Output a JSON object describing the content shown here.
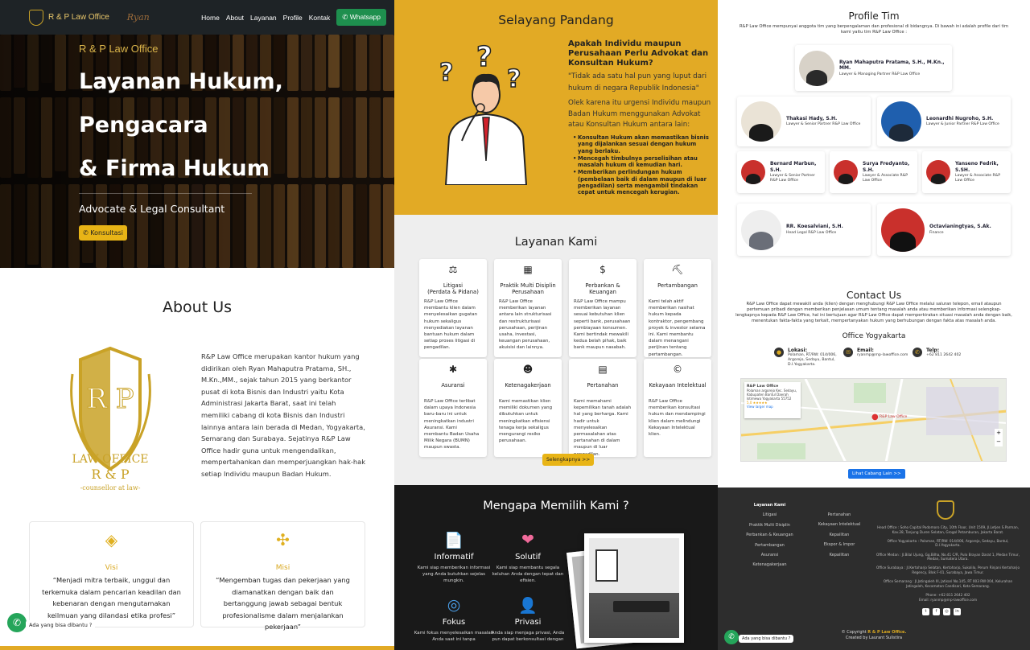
{
  "nav": {
    "brand": "R & P Law Office",
    "links": [
      "Home",
      "About",
      "Layanan",
      "Profile",
      "Kontak"
    ],
    "whatsapp": "Whatsapp",
    "signature": "Ryan"
  },
  "hero": {
    "subtitle": "R & P Law Office",
    "title_lines": [
      "Layanan Hukum,",
      "Pengacara",
      "& Firma Hukum"
    ],
    "tagline": "Advocate & Legal Consultant",
    "cta": "Konsultasi"
  },
  "about": {
    "heading": "About Us",
    "logo_text": [
      "LAW OFFICE",
      "R & P",
      "-counsellor at law-"
    ],
    "text": "R&P Law Office merupakan kantor hukum yang didirikan oleh Ryan Mahaputra Pratama, SH., M.Kn.,MM., sejak tahun 2015 yang berkantor pusat di kota Bisnis dan Industri yaitu Kota Administrasi Jakarta Barat, saat ini telah memiliki cabang di kota Bisnis dan Industri lainnya antara lain berada di Medan, Yogyakarta, Semarang dan Surabaya. Sejatinya R&P Law Office hadir guna untuk mengendalikan, mempertahankan dan memperjuangkan hak-hak setiap Individu maupun Badan Hukum.",
    "visi": {
      "title": "Visi",
      "quote": "“Menjadi mitra terbaik, unggul dan terkemuka dalam pencarian keadilan dan kebenaran dengan mengutamakan keilmuan yang dilandasi etika profesi”"
    },
    "misi": {
      "title": "Misi",
      "quote": "“Mengemban tugas dan pekerjaan yang diamanatkan dengan baik dan bertanggung jawab sebagai bentuk profesionalisme dalam menjalankan pekerjaan”"
    }
  },
  "chat": {
    "label": "Ada yang bisa dibantu ?"
  },
  "selayang": {
    "heading": "Selayang Pandang",
    "question": "Apakah Individu maupun Perusahaan Perlu Advokat dan Konsultan Hukum?",
    "quote": "\"Tidak ada satu hal pun yang luput dari hukum di negara Republik Indonesia\"",
    "para": "Olek karena itu urgensi Individu maupun Badan Hukum menggunakan Advokat atau Konsultan Hukum antara lain:",
    "points": [
      "Konsultan Hukum akan memastikan bisnis yang dijalankan sesuai dengan hukum yang berlaku.",
      "Mencegah timbulnya perselisihan atau masalah hukum di kemudian hari.",
      "Memberikan perlindungan hukum (pembelaan baik di dalam maupun di luar pengadilan) serta mengambil tindakan cepat untuk mencegah kerugian."
    ]
  },
  "layanan": {
    "heading": "Layanan Kami",
    "cards": [
      {
        "icon": "gavel-icon",
        "glyph": "⚖",
        "title": "Litigasi\n(Perdata & Pidana)",
        "desc": "R&P Law Office membantu klien dalam menyelesaikan gugatan hukum sekaligus menyediakan layanan bantuan hukum dalam setiap proses litigasi di pengadilan."
      },
      {
        "icon": "building-icon",
        "glyph": "▦",
        "title": "Praktik Multi Disiplin Perusahaan",
        "desc": "R&P Law Office memberikan layanan antara lain strukturisasi dan restrukturisasi perusahaan, perijinan usaha, investasi, keuangan perusahaan, akuisisi dan lainnya."
      },
      {
        "icon": "money-bag-icon",
        "glyph": "$",
        "title": "Perbankan & Keuangan",
        "desc": "R&P Law Office mampu memberikan layanan sesuai kebutuhan klien seperti bank, perusahaan pembiayaan konsumen. Kami bertindak mewakili kedua belah pihak, baik bank maupun nasabah."
      },
      {
        "icon": "mining-icon",
        "glyph": "⛏",
        "title": "Pertambangan",
        "desc": "Kami telah aktif memberikan nasihat hukum kepada kontraktor, pengembang proyek & investor selama ini. Kami membantu dalam menangani perijinan tentang pertambangan."
      },
      {
        "icon": "car-crash-icon",
        "glyph": "✱",
        "title": "Asuransi",
        "desc": "R&P Law Office terlibat dalam upaya Indonesia baru-baru ini untuk meningkatkan industri Asuransi. Kami membantu Badan Usaha Milik Negara (BUMN) maupun swasta."
      },
      {
        "icon": "people-icon",
        "glyph": "☻",
        "title": "Ketenagakerjaan",
        "desc": "Kami memastikan klien memiliki dokumen yang dibutuhkan untuk meningkatkan efisiensi tenaga kerja sekaligus mengurangi resiko perusahaan."
      },
      {
        "icon": "land-document-icon",
        "glyph": "▤",
        "title": "Pertanahan",
        "desc": "Kami memahami kepemilikan tanah adalah hal yang berharga. Kami hadir untuk menyelesaikan permasalahan atas pertanahan di dalam maupun di luar pengadilan."
      },
      {
        "icon": "copyright-icon",
        "glyph": "©",
        "title": "Kekayaan Intelektual",
        "desc": "R&P Law Office memberikan konsultasi hukum dan mendampingi klien dalam melindungi Kekayaan Intelektual klien."
      }
    ],
    "more": "Selengkapnya >>"
  },
  "why": {
    "heading": "Mengapa Memilih Kami ?",
    "features": [
      {
        "icon": "document-icon",
        "glyph": "📄",
        "title": "Informatif",
        "desc": "Kami siap memberikan informasi yang Anda butuhkan sejelas mungkin."
      },
      {
        "icon": "heart-icon",
        "glyph": "❤",
        "title": "Solutif",
        "desc": "Kami siap membantu segala keluhan Anda dengan tepat dan efisien."
      },
      {
        "icon": "target-icon",
        "glyph": "◎",
        "title": "Fokus",
        "desc": "Kami fokus menyelesaikan masalah Anda saat ini tanpa"
      },
      {
        "icon": "person-icon",
        "glyph": "👤",
        "title": "Privasi",
        "desc": "Anda siap menjaga privasi, Anda pun dapat berkonsultasi dengan"
      }
    ]
  },
  "team": {
    "heading": "Profile Tim",
    "sub": "R&P Law Office mempunyai anggota tim yang berpengalaman dan profesional di bidangnya. Di bawah ini adalah profile dari tim kami yaitu tim R&P Law Office :",
    "members": [
      {
        "name": "Ryan Mahaputra Pratama, S.H., M.Kn., MM.",
        "role": "Lawyer & Managing Partner R&P Law Office"
      },
      {
        "name": "Thakasi Hady, S.H.",
        "role": "Lawyer & Senior Partner R&P Law Office"
      },
      {
        "name": "Leonardhi Nugroho, S.H.",
        "role": "Lawyer & Junior Partner R&P Law Office"
      },
      {
        "name": "Bernard Marbun, S.H.",
        "role": "Lawyer & Senior Partner R&P Law Office"
      },
      {
        "name": "Surya Fredyanto, S.H.",
        "role": "Lawyer & Associate R&P Law Office"
      },
      {
        "name": "Yanseno Fedrik, S.SH.",
        "role": "Lawyer & Associate R&P Law Office"
      },
      {
        "name": "RR. Koesalviani, S.H.",
        "role": "Head Legal R&P Law Office"
      },
      {
        "name": "Octavianingtyas, S.Ak.",
        "role": "Finance"
      }
    ]
  },
  "contact": {
    "heading": "Contact Us",
    "sub": "R&P Law Office dapat mewakili anda (klien) dengan menghubungi R&P Law Office melalui saluran telepon, email ataupun pertemuan pribadi dengan memberikan penjelasan umum tentang masalah anda atau memberikan informasi selengkap-lengkapnya kepada R&P Law Office, hal ini bertujuan agar R&P Law Office dapat memperkirakan situasi masalah anda dengan baik, menentukan fakta-fakta yang terkait, mempertanyakan hukum yang berhubungan dengan fakta atas masalah anda.",
    "office": "Office Yogyakarta",
    "lokasi_label": "Lokasi:",
    "lokasi": "Polaman, RT/RW: 014/006, Argorejo, Sedayu, Bantul, D.I.Yogyakarta.",
    "email_label": "Email:",
    "email": "ryanmp@rnp-lawoffice.com",
    "telp_label": "Telp:",
    "telp": "+62 811 2642 402",
    "map_title": "R&P Law Office",
    "map_addr": "Polaman argorejo Kec. Sedayu, Kabupaten Bantul Daerah Istimewa Yogyakarta 55752",
    "map_rating": "5.0 ★★★★★",
    "map_link": "View larger map",
    "map_pin": "R&P Law Office",
    "btn": "Lihat Cabang Lain >>"
  },
  "footer": {
    "col1_head": "Layanan Kami",
    "col1": [
      "Litigasi",
      "Praktik Multi Disiplin",
      "Perbankan & Keuangan",
      "Pertambangan",
      "Asuransi",
      "Ketenagakerjaan"
    ],
    "col2": [
      "Pertanahan",
      "Kekayaan Intelektual",
      "Kepailitan",
      "Ekspor & Impor",
      "Kepailitan"
    ],
    "addr": "Head Office : Soho Capital Podomoro City, 10th Floor, Unit 1509, Jl.Letjen S.Parman, Kav.28, Tanjung Duren Selatan, Grogol Petamburan, Jakarta Barat.\n\nOffice Yogyakarta : Polaman, RT/RW: 014/006, Argorejo, Sedayu, Bantul, D.I.Yogyakarta.\n\nOffice Medan : Jl.Bilal Ujung, Gg.Bilha, No.41 C/R, Pulo Brayan Darat 1, Medan Timur, Medan, Sumatera Utara.\n\nOffice Surabaya : Jl.Kertoharjo Selatan, Kertoharjo, Sukolilo, Perum Rinjani Kertoharjo Regency, Blok F-01, Surabaya, Jawa Timur.\n\nOffice Semarang : Jl.Jatingaleh III, Jatisari No.145, RT 003 RW 004, Kelurahan Jatingaleh, Kecamatan Candisari, Kota Semarang.\n\nPhone: +62 811 2642 402\nEmail: ryanmp@rnp-lawoffice.com",
    "copyright_prefix": "© Copyright ",
    "copyright_brand": "R & P Law Office.",
    "created": "Created by Laurant Sulistira"
  }
}
